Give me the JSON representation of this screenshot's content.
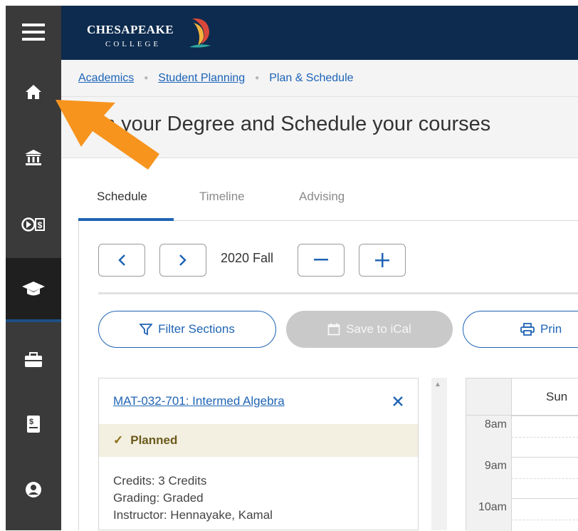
{
  "header": {
    "logo_line1": "CHESAPEAKE",
    "logo_line2": "COLLEGE"
  },
  "sidebar": {
    "items": [
      {
        "icon": "menu-icon"
      },
      {
        "icon": "home-icon"
      },
      {
        "icon": "institution-icon"
      },
      {
        "icon": "finance-icon"
      },
      {
        "icon": "graduation-cap-icon",
        "active": true
      },
      {
        "icon": "briefcase-icon"
      },
      {
        "icon": "document-dollar-icon"
      },
      {
        "icon": "user-icon"
      }
    ]
  },
  "breadcrumb": {
    "item1": "Academics",
    "item2": "Student Planning",
    "item3": "Plan & Schedule"
  },
  "page": {
    "title": "n your Degree and Schedule your courses"
  },
  "tabs": {
    "schedule": "Schedule",
    "timeline": "Timeline",
    "advising": "Advising"
  },
  "term": {
    "label": "2020 Fall",
    "prev": "‹",
    "next": "›",
    "remove": "−",
    "add": "+"
  },
  "actions": {
    "filter": "Filter Sections",
    "ical": "Save to iCal",
    "print": "Print"
  },
  "course": {
    "title": "MAT-032-701: Intermed Algebra",
    "close": "✕",
    "status": "Planned",
    "credits": "Credits: 3 Credits",
    "grading": "Grading: Graded",
    "instructor": "Instructor: Hennayake, Kamal"
  },
  "calendar": {
    "day": "Sun",
    "hours": [
      "8am",
      "9am",
      "10am"
    ]
  },
  "colors": {
    "header_bg": "#0d2b4e",
    "sidebar_bg": "#3a3a3a",
    "accent": "#1f64b4",
    "annotation_arrow": "#f7941d"
  }
}
